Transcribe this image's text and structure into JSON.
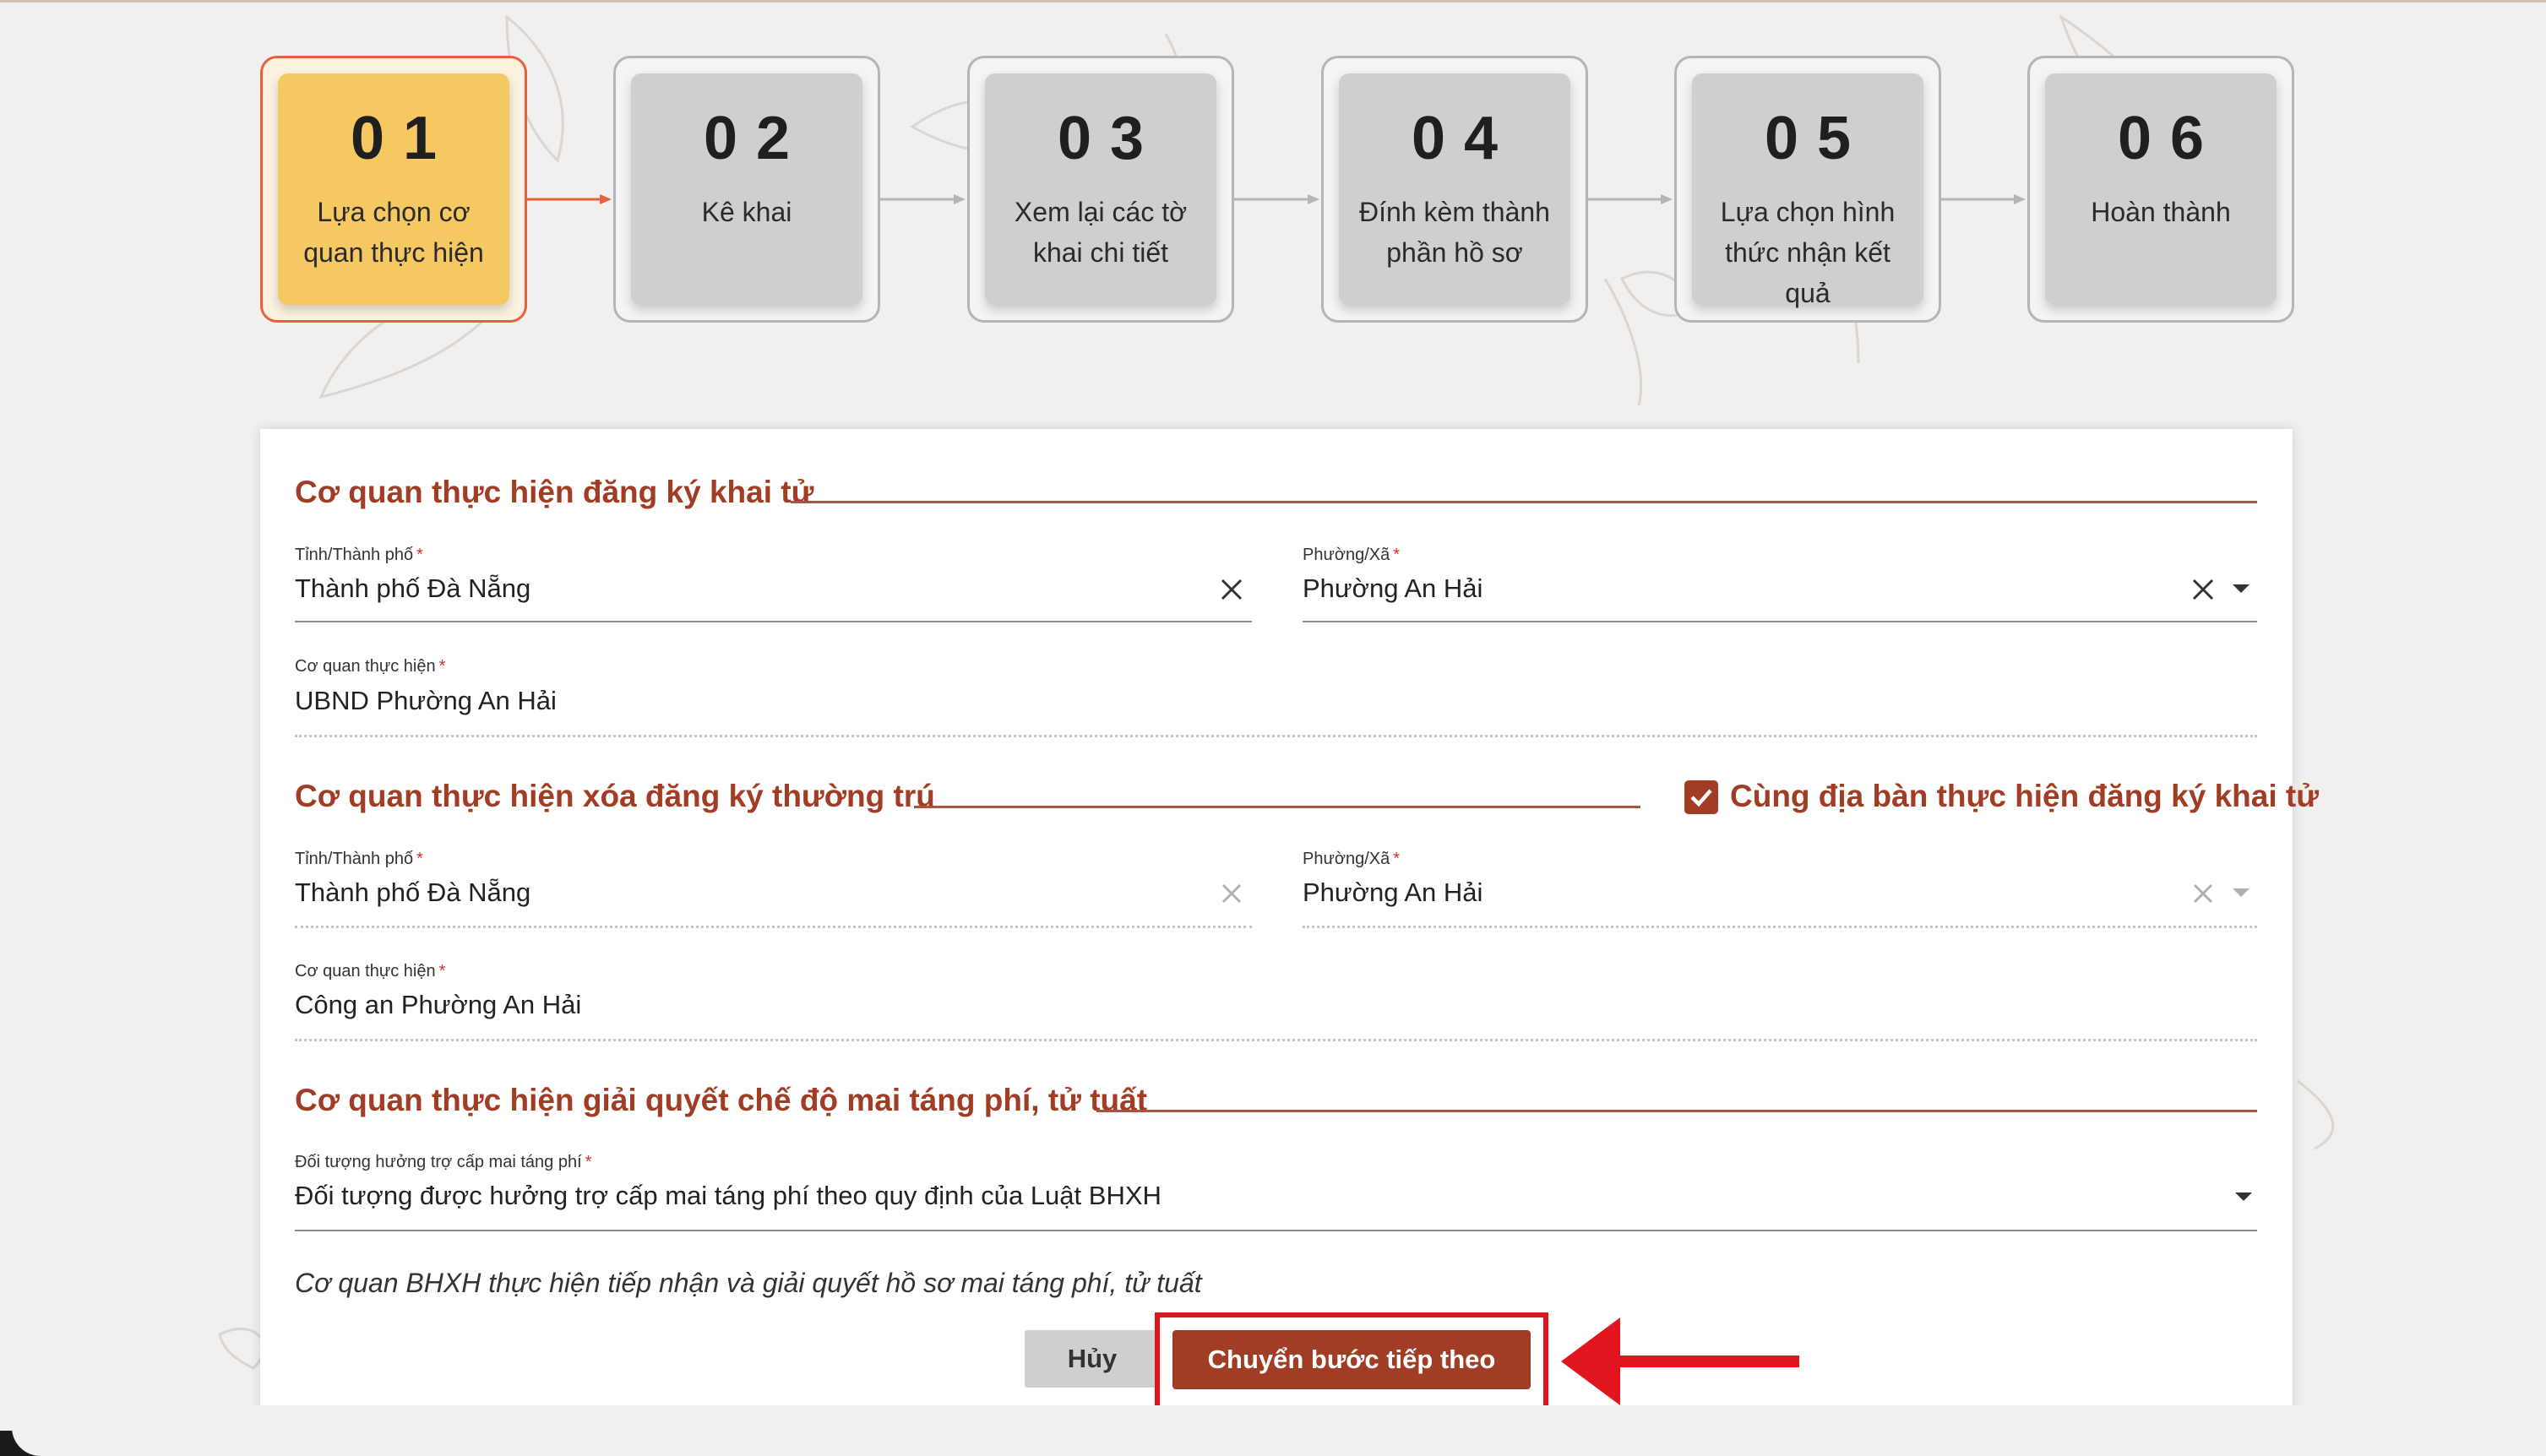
{
  "steps": [
    {
      "num": "01",
      "label": "Lựa chọn cơ quan thực hiện",
      "active": true
    },
    {
      "num": "02",
      "label": "Kê khai",
      "active": false
    },
    {
      "num": "03",
      "label": "Xem lại các tờ khai chi tiết",
      "active": false
    },
    {
      "num": "04",
      "label": "Đính kèm thành phần hồ sơ",
      "active": false
    },
    {
      "num": "05",
      "label": "Lựa chọn hình thức nhận kết quả",
      "active": false
    },
    {
      "num": "06",
      "label": "Hoàn thành",
      "active": false
    }
  ],
  "section1": {
    "title": "Cơ quan thực hiện đăng ký khai tử",
    "province": {
      "label": "Tỉnh/Thành phố",
      "value": "Thành phố Đà Nẵng"
    },
    "ward": {
      "label": "Phường/Xã",
      "value": "Phường An Hải"
    },
    "agency": {
      "label": "Cơ quan thực hiện",
      "value": "UBND Phường An Hải"
    }
  },
  "section2": {
    "title": "Cơ quan thực hiện xóa đăng ký thường trú",
    "same_area_checkbox": {
      "label": "Cùng địa bàn thực hiện đăng ký khai tử",
      "checked": true
    },
    "province": {
      "label": "Tỉnh/Thành phố",
      "value": "Thành phố Đà Nẵng"
    },
    "ward": {
      "label": "Phường/Xã",
      "value": "Phường An Hải"
    },
    "agency": {
      "label": "Cơ quan thực hiện",
      "value": "Công an Phường An Hải"
    }
  },
  "section3": {
    "title": "Cơ quan thực hiện giải quyết chế độ mai táng phí, tử tuất",
    "beneficiary": {
      "label": "Đối tượng hưởng trợ cấp mai táng phí",
      "value": "Đối tượng được hưởng trợ cấp mai táng phí theo quy định của Luật BHXH"
    },
    "note": "Cơ quan BHXH thực hiện tiếp nhận và giải quyết hồ sơ mai táng phí, tử tuất"
  },
  "actions": {
    "cancel_label": "Hủy",
    "next_label": "Chuyển bước tiếp theo"
  },
  "required_mark": "*",
  "colors": {
    "accent": "#a13d24",
    "active_step": "#f5c862",
    "active_border": "#e8603c",
    "highlight": "#e2141e"
  },
  "icons": [
    "clear-icon",
    "dropdown-caret-icon",
    "check-icon",
    "arrow-right-icon"
  ]
}
